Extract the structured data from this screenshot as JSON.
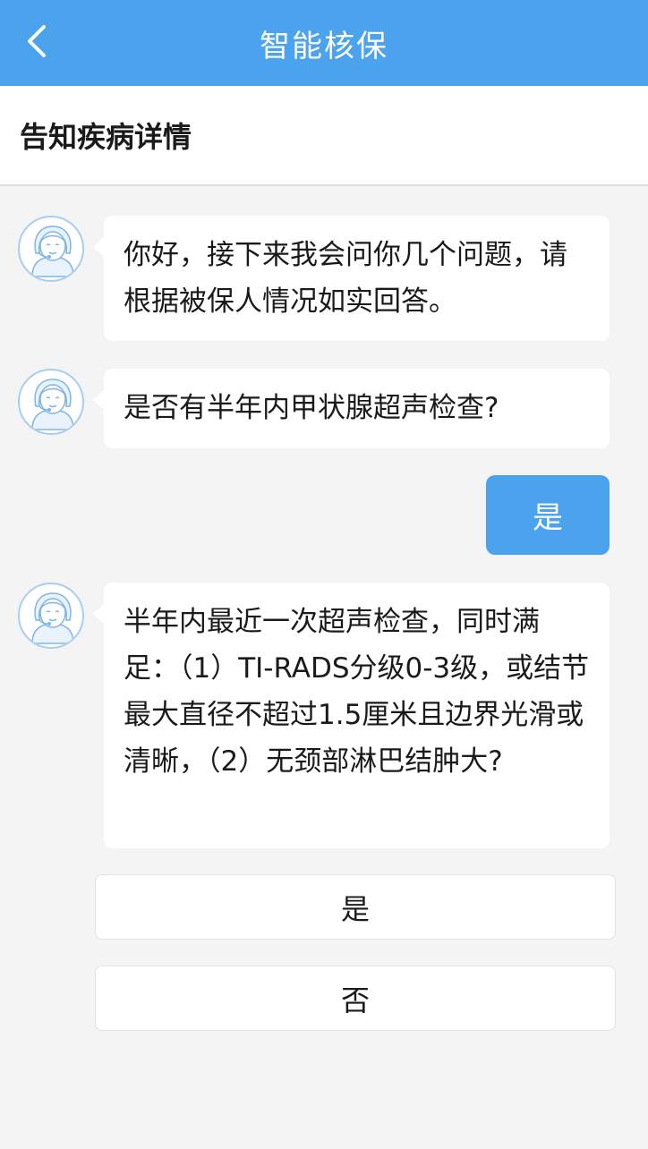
{
  "header": {
    "title": "智能核保",
    "back_icon": "chevron-left-icon",
    "background": "#4aa3ec"
  },
  "subheader": {
    "title": "告知疾病详情"
  },
  "chat": {
    "messages": [
      {
        "sender": "agent",
        "text": "你好，接下来我会问你几个问题，请根据被保人情况如实回答。"
      },
      {
        "sender": "agent",
        "text": "是否有半年内甲状腺超声检查?"
      },
      {
        "sender": "user",
        "text": "是"
      },
      {
        "sender": "agent",
        "text": "半年内最近一次超声检查，同时满足：（1）TI-RADS分级0-3级，或结节最大直径不超过1.5厘米且边界光滑或清晰，（2）无颈部淋巴结肿大?"
      }
    ]
  },
  "options": [
    {
      "label": "是"
    },
    {
      "label": "否"
    }
  ],
  "colors": {
    "accent": "#4aa3ec",
    "page_bg": "#f4f4f4",
    "bubble_bg": "#ffffff"
  }
}
